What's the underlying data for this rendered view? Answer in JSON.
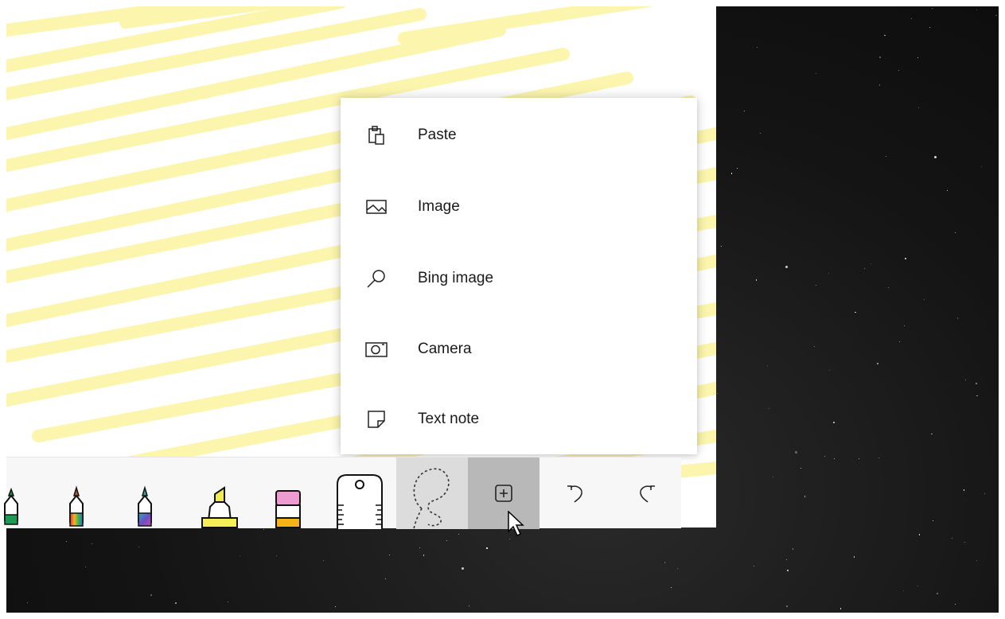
{
  "menu": {
    "items": [
      {
        "label": "Paste",
        "icon": "clipboard-icon"
      },
      {
        "label": "Image",
        "icon": "picture-icon"
      },
      {
        "label": "Bing image",
        "icon": "search-icon"
      },
      {
        "label": "Camera",
        "icon": "camera-icon"
      },
      {
        "label": "Text note",
        "icon": "sticky-note-icon"
      }
    ]
  },
  "toolbar": {
    "tools": [
      {
        "name": "pen-green",
        "icon": "pen-icon"
      },
      {
        "name": "pen-rainbow",
        "icon": "pen-icon"
      },
      {
        "name": "pen-galaxy",
        "icon": "pen-icon"
      },
      {
        "name": "highlighter-yellow",
        "icon": "highlighter-icon"
      },
      {
        "name": "eraser",
        "icon": "eraser-icon"
      },
      {
        "name": "ruler",
        "icon": "ruler-icon"
      },
      {
        "name": "lasso-select",
        "icon": "lasso-icon"
      },
      {
        "name": "add",
        "icon": "plus-box-icon"
      },
      {
        "name": "undo",
        "icon": "undo-icon"
      },
      {
        "name": "redo",
        "icon": "redo-icon"
      }
    ]
  },
  "colors": {
    "highlight_stroke": "#fbf5a9",
    "menu_background": "#ffffff",
    "add_button_active": "#b8b8b8",
    "lasso_button_bg": "#dcdcdc"
  }
}
